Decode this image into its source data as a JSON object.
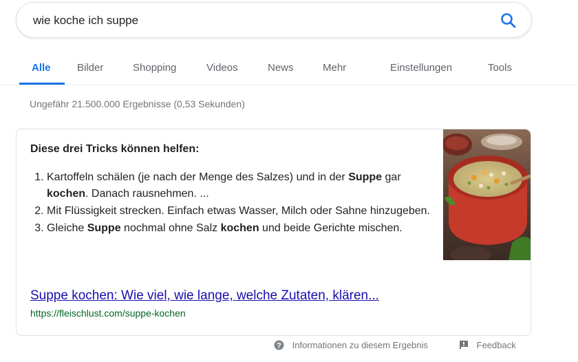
{
  "search": {
    "query": "wie koche ich suppe"
  },
  "tabs": {
    "all": "Alle",
    "images": "Bilder",
    "shopping": "Shopping",
    "videos": "Videos",
    "news": "News",
    "more": "Mehr",
    "settings": "Einstellungen",
    "tools": "Tools"
  },
  "result_stats": "Ungefähr 21.500.000 Ergebnisse (0,53 Sekunden)",
  "snippet": {
    "heading": "Diese drei Tricks können helfen:",
    "steps": [
      {
        "p1": "Kartoffeln schälen (je nach der Menge des Salzes) und in der ",
        "b1": "Suppe",
        "p2": " gar ",
        "b2": "kochen",
        "p3": ". Danach rausnehmen. ..."
      },
      {
        "text": "Mit Flüssigkeit strecken. Einfach etwas Wasser, Milch oder Sahne hinzugeben."
      },
      {
        "p1": "Gleiche ",
        "b1": "Suppe",
        "p2": " nochmal ohne Salz ",
        "b2": "kochen",
        "p3": " und beide Gerichte mischen."
      }
    ],
    "link_title": "Suppe kochen: Wie viel, wie lange, welche Zutaten, klären...",
    "link_url": "https://fleischlust.com/suppe-kochen"
  },
  "footer": {
    "info_label": "Informationen zu diesem Ergebnis",
    "feedback_label": "Feedback"
  },
  "colors": {
    "accent": "#1a73e8",
    "link": "#1a0dab",
    "url": "#006621",
    "muted": "#70757a"
  },
  "icons": {
    "search": "search-icon",
    "info": "question-circle-icon",
    "feedback": "feedback-flag-icon"
  }
}
